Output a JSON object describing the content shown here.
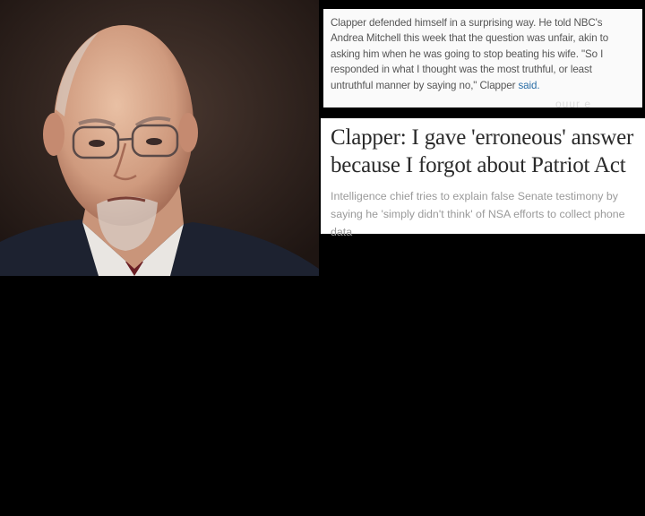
{
  "quote": {
    "text": "Clapper defended himself in a surprising way. He told NBC's Andrea Mitchell this week that the question was unfair, akin to asking him when he was going to stop beating his wife. \"So I responded in what I thought was the most truthful, or least untruthful manner by saying no,\" Clapper",
    "link_word": "said."
  },
  "stray_text": "ouur e",
  "article": {
    "headline": "Clapper: I gave 'erroneous' answer because I forgot about Patriot Act",
    "subhead": "Intelligence chief tries to explain false Senate testimony by saying he 'simply didn't think' of NSA efforts to collect phone data"
  },
  "photo": {
    "subject": "portrait-photo"
  }
}
